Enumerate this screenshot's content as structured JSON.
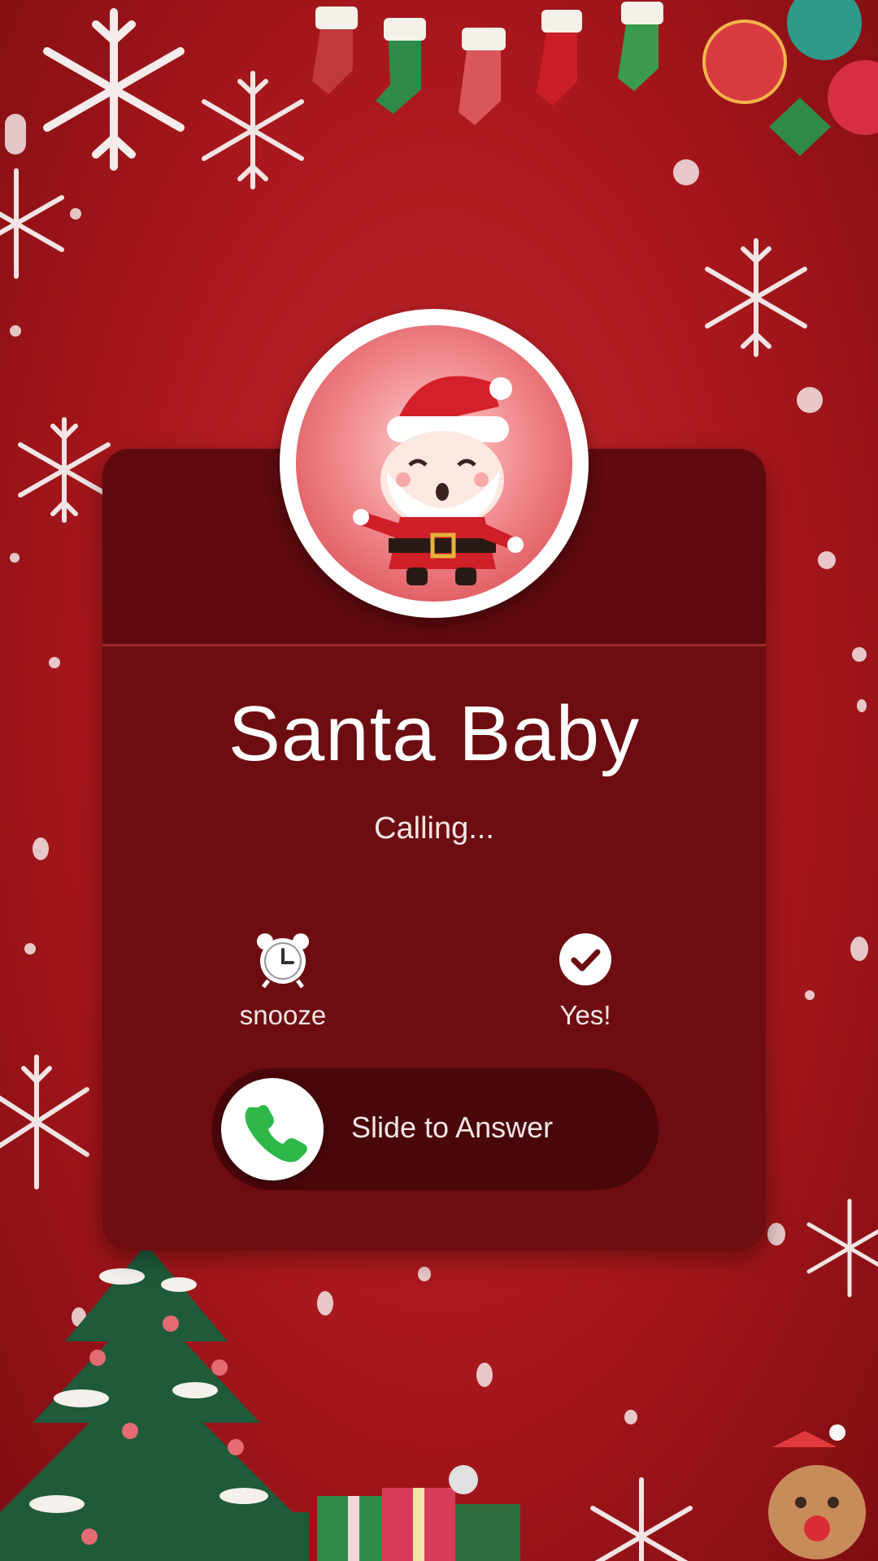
{
  "caller": {
    "name": "Santa Baby",
    "status": "Calling..."
  },
  "actions": {
    "snooze_label": "snooze",
    "yes_label": "Yes!"
  },
  "answer": {
    "label": "Slide to Answer"
  },
  "colors": {
    "background": "#b0191e",
    "card": "#6d0d11",
    "answer_icon": "#2fb84a"
  },
  "icons": [
    "alarm-clock-icon",
    "check-icon",
    "phone-icon"
  ]
}
